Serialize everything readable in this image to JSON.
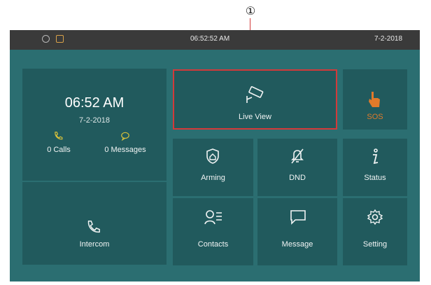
{
  "callout_number": "①",
  "statusbar": {
    "time": "06:52:52  AM",
    "date": "7-2-2018",
    "icons": [
      "sync-icon",
      "shield-icon"
    ]
  },
  "clock": {
    "time": "06:52 AM",
    "date": "7-2-2018"
  },
  "counters": {
    "calls": "0 Calls",
    "messages": "0 Messages"
  },
  "tiles": {
    "intercom": "Intercom",
    "live_view": "Live View",
    "sos": "SOS",
    "arming": "Arming",
    "dnd": "DND",
    "status": "Status",
    "contacts": "Contacts",
    "message": "Message",
    "setting": "Setting"
  },
  "colors": {
    "background": "#2b6e71",
    "tile": "#215a5d",
    "highlight": "#d23a3a",
    "sos": "#e07a2a",
    "accent_yellow": "#d9c23a"
  }
}
